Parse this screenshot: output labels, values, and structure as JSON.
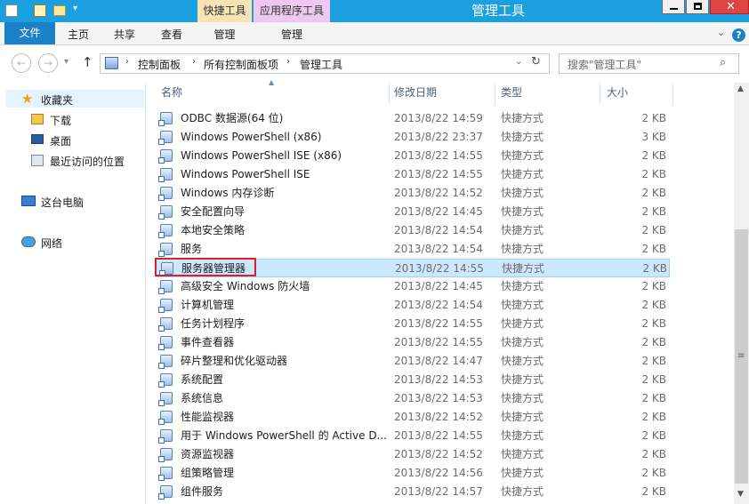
{
  "window": {
    "title": "管理工具",
    "context_tab_quick": "快捷工具",
    "context_tab_app": "应用程序工具"
  },
  "ribbon": {
    "tabs": [
      "文件",
      "主页",
      "共享",
      "查看",
      "管理",
      "管理"
    ]
  },
  "address": {
    "crumbs": [
      "控制面板",
      "所有控制面板项",
      "管理工具"
    ],
    "search_placeholder": "搜索\"管理工具\""
  },
  "nav": {
    "favorites": "收藏夹",
    "downloads": "下载",
    "desktop": "桌面",
    "recent": "最近访问的位置",
    "this_pc": "这台电脑",
    "network": "网络"
  },
  "columns": {
    "name": "名称",
    "date": "修改日期",
    "type": "类型",
    "size": "大小"
  },
  "files": [
    {
      "name": "ODBC 数据源(64 位)",
      "date": "2013/8/22 14:59",
      "type": "快捷方式",
      "size": "2 KB"
    },
    {
      "name": "Windows PowerShell (x86)",
      "date": "2013/8/22 23:37",
      "type": "快捷方式",
      "size": "3 KB"
    },
    {
      "name": "Windows PowerShell ISE (x86)",
      "date": "2013/8/22 14:55",
      "type": "快捷方式",
      "size": "2 KB"
    },
    {
      "name": "Windows PowerShell ISE",
      "date": "2013/8/22 14:55",
      "type": "快捷方式",
      "size": "2 KB"
    },
    {
      "name": "Windows 内存诊断",
      "date": "2013/8/22 14:52",
      "type": "快捷方式",
      "size": "2 KB"
    },
    {
      "name": "安全配置向导",
      "date": "2013/8/22 14:45",
      "type": "快捷方式",
      "size": "2 KB"
    },
    {
      "name": "本地安全策略",
      "date": "2013/8/22 14:54",
      "type": "快捷方式",
      "size": "2 KB"
    },
    {
      "name": "服务",
      "date": "2013/8/22 14:54",
      "type": "快捷方式",
      "size": "2 KB"
    },
    {
      "name": "服务器管理器",
      "date": "2013/8/22 14:55",
      "type": "快捷方式",
      "size": "2 KB"
    },
    {
      "name": "高级安全 Windows 防火墙",
      "date": "2013/8/22 14:45",
      "type": "快捷方式",
      "size": "2 KB"
    },
    {
      "name": "计算机管理",
      "date": "2013/8/22 14:54",
      "type": "快捷方式",
      "size": "2 KB"
    },
    {
      "name": "任务计划程序",
      "date": "2013/8/22 14:55",
      "type": "快捷方式",
      "size": "2 KB"
    },
    {
      "name": "事件查看器",
      "date": "2013/8/22 14:55",
      "type": "快捷方式",
      "size": "2 KB"
    },
    {
      "name": "碎片整理和优化驱动器",
      "date": "2013/8/22 14:47",
      "type": "快捷方式",
      "size": "2 KB"
    },
    {
      "name": "系统配置",
      "date": "2013/8/22 14:53",
      "type": "快捷方式",
      "size": "2 KB"
    },
    {
      "name": "系统信息",
      "date": "2013/8/22 14:53",
      "type": "快捷方式",
      "size": "2 KB"
    },
    {
      "name": "性能监视器",
      "date": "2013/8/22 14:52",
      "type": "快捷方式",
      "size": "2 KB"
    },
    {
      "name": "用于 Windows PowerShell 的 Active D...",
      "date": "2013/8/22 14:55",
      "type": "快捷方式",
      "size": "2 KB"
    },
    {
      "name": "资源监视器",
      "date": "2013/8/22 14:52",
      "type": "快捷方式",
      "size": "2 KB"
    },
    {
      "name": "组策略管理",
      "date": "2013/8/22 14:56",
      "type": "快捷方式",
      "size": "2 KB"
    },
    {
      "name": "组件服务",
      "date": "2013/8/22 14:57",
      "type": "快捷方式",
      "size": "2 KB"
    }
  ],
  "selected_index": 8,
  "colors": {
    "titlebar": "#1a9fe0",
    "file_tab": "#1c80c6",
    "selection": "#cce8ff",
    "highlight_box": "#e02020"
  }
}
